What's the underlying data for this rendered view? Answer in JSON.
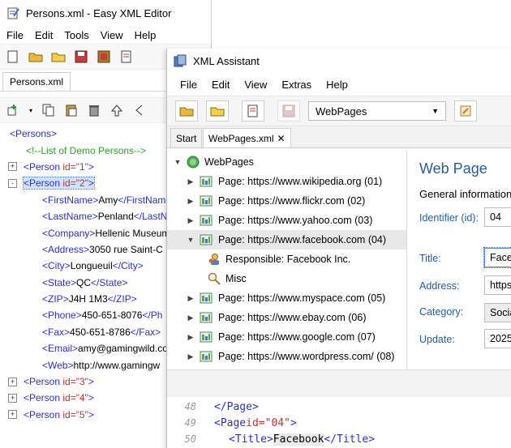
{
  "back_window": {
    "title": "Persons.xml - Easy XML Editor",
    "menu": [
      "File",
      "Edit",
      "Tools",
      "View",
      "Help"
    ],
    "tab": "Persons.xml",
    "tree": [
      {
        "text": "<Persons>",
        "kind": "tag",
        "indent": 0
      },
      {
        "text": "<!--List of Demo Persons-->",
        "kind": "comment",
        "indent": 1
      },
      {
        "tag": "<Person ",
        "attr": "id=\"1\"",
        "close": ">",
        "kind": "node",
        "indent": 1,
        "expand": "+"
      },
      {
        "tag": "<Person ",
        "attr": "id=\"2\"",
        "close": ">",
        "kind": "node",
        "indent": 1,
        "expand": "-",
        "selected": true
      },
      {
        "open": "<FirstName>",
        "value": "Amy",
        "end": "</FirstName>",
        "indent": 2
      },
      {
        "open": "<LastName>",
        "value": "Penland",
        "end": "</LastName>",
        "indent": 2
      },
      {
        "open": "<Company>",
        "value": "Hellenic Museum",
        "end": "",
        "indent": 2
      },
      {
        "open": "<Address>",
        "value": "3050 rue Saint-C",
        "end": "",
        "indent": 2
      },
      {
        "open": "<City>",
        "value": "Longueuil",
        "end": "</City>",
        "indent": 2
      },
      {
        "open": "<State>",
        "value": "QC",
        "end": "</State>",
        "indent": 2
      },
      {
        "open": "<ZIP>",
        "value": "J4H 1M3",
        "end": "</ZIP>",
        "indent": 2
      },
      {
        "open": "<Phone>",
        "value": "450-651-8076",
        "end": "</Ph",
        "indent": 2
      },
      {
        "open": "<Fax>",
        "value": "450-651-8786",
        "end": "</Fax>",
        "indent": 2
      },
      {
        "open": "<Email>",
        "value": "amy@gamingwild.co",
        "end": "",
        "indent": 2
      },
      {
        "open": "<Web>",
        "value": "http://www.gamingw",
        "end": "",
        "indent": 2
      },
      {
        "tag": "<Person ",
        "attr": "id=\"3\"",
        "close": ">",
        "kind": "node",
        "indent": 1,
        "expand": "+"
      },
      {
        "tag": "<Person ",
        "attr": "id=\"4\"",
        "close": ">",
        "kind": "node",
        "indent": 1,
        "expand": "+"
      },
      {
        "tag": "<Person ",
        "attr": "id=\"5\"",
        "close": ">",
        "kind": "node",
        "indent": 1,
        "expand": "+"
      }
    ]
  },
  "front_window": {
    "title": "XML Assistant",
    "menu": [
      "File",
      "Edit",
      "View",
      "Extras",
      "Help"
    ],
    "dropdown_value": "WebPages",
    "tabs": [
      "Start",
      "WebPages.xml"
    ],
    "tab_close": "✕",
    "tree_root": "WebPages",
    "tree": [
      {
        "label": "Page: https://www.wikipedia.org (01)",
        "arrow": "▶"
      },
      {
        "label": "Page: https://www.flickr.com (02)",
        "arrow": "▶"
      },
      {
        "label": "Page: https://www.yahoo.com (03)",
        "arrow": "▶"
      },
      {
        "label": "Page: https://www.facebook.com (04)",
        "arrow": "▼",
        "highlight": true
      },
      {
        "label": "Responsible: Facebook Inc.",
        "child": true,
        "icon": "person"
      },
      {
        "label": "Misc",
        "child": true,
        "icon": "search"
      },
      {
        "label": "Page: https://www.myspace.com (05)",
        "arrow": "▶"
      },
      {
        "label": "Page: https://www.ebay.com (06)",
        "arrow": "▶"
      },
      {
        "label": "Page: https://www.google.com (07)",
        "arrow": "▶"
      },
      {
        "label": "Page: https://www.wordpress.com/ (08)",
        "arrow": "▶"
      }
    ],
    "detail": {
      "heading": "Web Page",
      "section": "General information",
      "fields": [
        {
          "label": "Identifier (id):",
          "value": "04"
        },
        {
          "label": "Title:",
          "value": "Face"
        },
        {
          "label": "Address:",
          "value": "https"
        },
        {
          "label": "Category:",
          "value": "Socia"
        },
        {
          "label": "Update:",
          "value": "2025"
        }
      ]
    },
    "code": [
      {
        "num": "48",
        "indent": 1,
        "open": "</Page>",
        "attr": "",
        "close": "",
        "text": "",
        "end": ""
      },
      {
        "num": "49",
        "indent": 1,
        "open": "<Page ",
        "attr": "id=\"04\"",
        "close": ">",
        "text": "",
        "end": ""
      },
      {
        "num": "50",
        "indent": 2,
        "open": "<Title>",
        "attr": "",
        "close": "",
        "text": "Facebook",
        "end": "</Title>"
      }
    ]
  },
  "colors": {
    "tag": "#2c2cd6",
    "attr": "#c03030",
    "comment": "#2ea02e",
    "label": "#2a5b9a",
    "heading": "#2a5b9a"
  }
}
